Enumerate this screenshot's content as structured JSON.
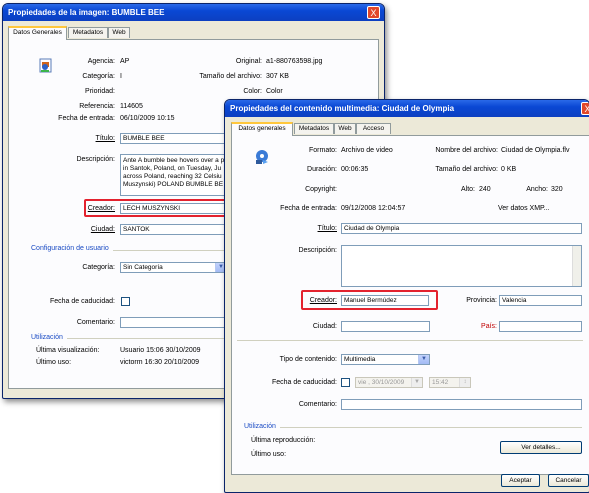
{
  "win1": {
    "title": "Propiedades de la imagen: BUMBLE BEE",
    "close": "X",
    "tabs": [
      "Datos Generales",
      "Metadatos",
      "Web"
    ],
    "agency_label": "Agencia:",
    "agency": "AP",
    "original_label": "Original:",
    "original": "a1-880763598.jpg",
    "category_label": "Categoría:",
    "category": "I",
    "filesize_label": "Tamaño del archivo:",
    "filesize": "307 KB",
    "priority_label": "Prioridad:",
    "color_label": "Color:",
    "color": "Color",
    "reference_label": "Referencia:",
    "reference": "114605",
    "entry_label": "Fecha de entrada:",
    "entry": "06/10/2009 10:15",
    "title_label": "Título:",
    "title_value": "BUMBLE BEE",
    "desc_label": "Descripción:",
    "desc_lines": [
      "Ante A bumble bee hovers over a p",
      "in Santok, Poland, on Tuesday, Ju",
      "across Poland, reaching 32 Celsiu",
      "Muszynski) POLAND BUMBLE BE"
    ],
    "creator_label": "Creador:",
    "creator": "LECH MUSZYNSKI",
    "city_label": "Ciudad:",
    "city": "SANTOK",
    "user_config": "Configuración de usuario",
    "user_cat_label": "Categoría:",
    "user_cat": "Sin Categoría",
    "expiry_label": "Fecha de caducidad:",
    "comment_label": "Comentario:",
    "utilization": "Utilización",
    "last_view_label": "Última visualización:",
    "last_view": "Usuario 15:06  30/10/2009",
    "last_use_label": "Último uso:",
    "last_use": "victorm  16:30  20/10/2009"
  },
  "win2": {
    "title": "Propiedades del contenido multimedia: Ciudad de Olympia",
    "close": "X",
    "tabs": [
      "Datos generales",
      "Metadatos",
      "Web",
      "Acceso"
    ],
    "format_label": "Formato:",
    "format": "Archivo de video",
    "filename_label": "Nombre del archivo:",
    "filename": "Ciudad de Olympia.flv",
    "duration_label": "Duración:",
    "duration": "00:06:35",
    "filesize_label": "Tamaño del archivo:",
    "filesize": "0 KB",
    "copyright_label": "Copyright:",
    "height_label": "Alto:",
    "height": "240",
    "width_label": "Ancho:",
    "width": "320",
    "entry_label": "Fecha de entrada:",
    "entry": "09/12/2008 12:04:57",
    "xmp_link": "Ver datos XMP...",
    "title_label": "Título:",
    "title_value": "Ciudad de Olympia",
    "desc_label": "Descripción:",
    "creator_label": "Creador:",
    "creator": "Manuel Bermúdez",
    "province_label": "Provincia:",
    "province": "Valencia",
    "city_label": "Ciudad:",
    "country_label": "País:",
    "content_type_label": "Tipo de contenido:",
    "content_type": "Multimedia",
    "expiry_label": "Fecha de caducidad:",
    "expiry_date": "vie , 30/10/2009",
    "expiry_time": "15:42",
    "comment_label": "Comentario:",
    "utilization": "Utilización",
    "last_play_label": "Última reproducción:",
    "last_use_label": "Último uso:",
    "details_button": "Ver detalles...",
    "accept_button": "Aceptar",
    "cancel_button": "Cancelar"
  },
  "colors": {
    "titlebar": "#0a48d4",
    "highlight": "#e3222e",
    "group": "#1a4bc4"
  }
}
